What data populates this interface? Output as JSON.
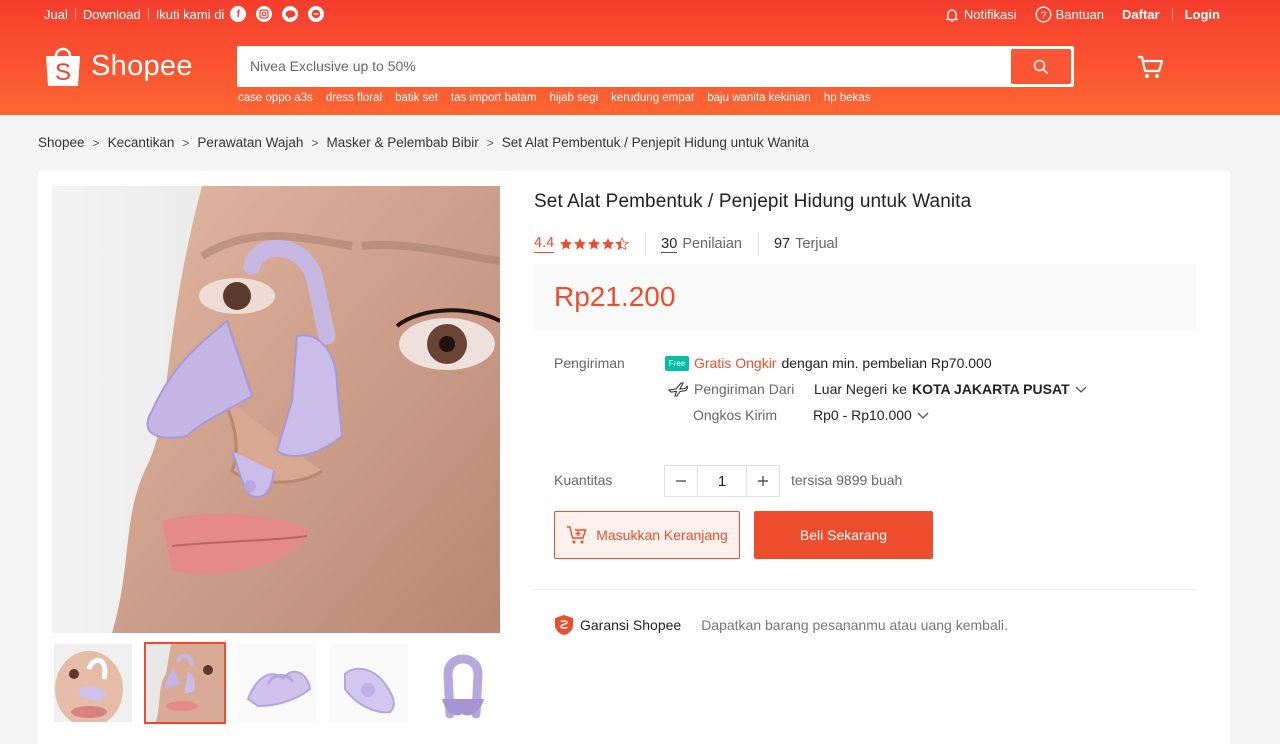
{
  "topbar": {
    "sell": "Jual",
    "download": "Download",
    "follow": "Ikuti kami di",
    "social": [
      "facebook-icon",
      "instagram-icon",
      "line-icon",
      "shopee-icon"
    ],
    "notifications": "Notifikasi",
    "help": "Bantuan",
    "register": "Daftar",
    "login": "Login"
  },
  "brand": {
    "name": "Shopee",
    "accent": "#ee4d2d"
  },
  "search": {
    "placeholder": "Nivea Exclusive up to 50%",
    "keywords": [
      "case oppo a3s",
      "dress floral",
      "batik set",
      "tas import batam",
      "hijab segi",
      "kerudung empat",
      "baju wanita kekinian",
      "hp bekas"
    ]
  },
  "breadcrumb": [
    "Shopee",
    "Kecantikan",
    "Perawatan Wajah",
    "Masker & Pelembab Bibir",
    "Set Alat Pembentuk / Penjepit Hidung untuk Wanita"
  ],
  "product": {
    "title": "Set Alat Pembentuk / Penjepit Hidung untuk Wanita",
    "rating": "4.4",
    "stars": 4.4,
    "reviews_count": "30",
    "reviews_label": "Penilaian",
    "sold_count": "97",
    "sold_label": "Terjual",
    "price": "Rp21.200"
  },
  "shipping": {
    "label": "Pengiriman",
    "free_badge": "Free",
    "free_text": "Gratis Ongkir",
    "free_condition": "dengan min. pembelian Rp70.000",
    "from_label": "Pengiriman Dari",
    "from_value": "Luar Negeri",
    "to_prefix": "ke",
    "to_city": "KOTA JAKARTA PUSAT",
    "cost_label": "Ongkos Kirim",
    "cost_value": "Rp0 - Rp10.000"
  },
  "quantity": {
    "label": "Kuantitas",
    "value": "1",
    "stock": "tersisa 9899 buah"
  },
  "actions": {
    "add_to_cart": "Masukkan Keranjang",
    "buy_now": "Beli Sekarang"
  },
  "guarantee": {
    "name": "Garansi Shopee",
    "desc": "Dapatkan barang pesananmu atau uang kembali."
  },
  "thumbnails": {
    "count": 5,
    "selected_index": 1
  }
}
